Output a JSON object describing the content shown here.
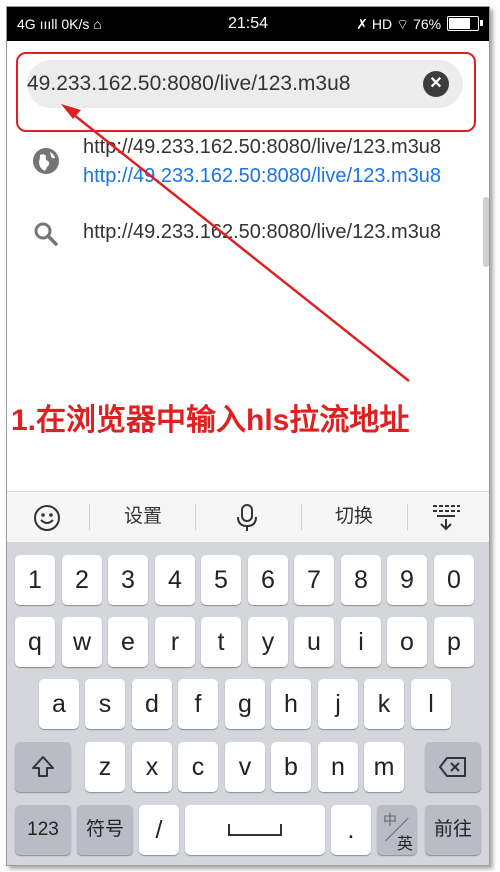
{
  "status_bar": {
    "left": "4G ıııll  0K/s ⌂",
    "time": "21:54",
    "right": "HD ⌔ 76%"
  },
  "url_bar": {
    "value": "49.233.162.50:8080/live/123.m3u8",
    "clear_icon": "close-icon"
  },
  "suggestions": [
    {
      "icon": "globe-icon",
      "title": "http://49.233.162.50:8080/live/123.m3u8",
      "url": "http://49.233.162.50:8080/live/123.m3u8"
    },
    {
      "icon": "search-icon",
      "title": "http://49.233.162.50:8080/live/123.m3u8"
    }
  ],
  "annotation": {
    "text": "1.在浏览器中输入hls拉流地址",
    "color": "#e02020"
  },
  "keyboard_toolbar": {
    "emoji_icon": "smiley-icon",
    "settings": "设置",
    "voice_icon": "microphone-icon",
    "switch": "切换",
    "collapse_icon": "keyboard-collapse-icon"
  },
  "keyboard": {
    "numbers": [
      "1",
      "2",
      "3",
      "4",
      "5",
      "6",
      "7",
      "8",
      "9",
      "0"
    ],
    "row1": [
      "q",
      "w",
      "e",
      "r",
      "t",
      "y",
      "u",
      "i",
      "o",
      "p"
    ],
    "row2": [
      "a",
      "s",
      "d",
      "f",
      "g",
      "h",
      "j",
      "k",
      "l"
    ],
    "row3": [
      "z",
      "x",
      "c",
      "v",
      "b",
      "n",
      "m"
    ],
    "shift_icon": "shift-icon",
    "backspace_icon": "backspace-icon",
    "bottom": {
      "num_mode": "123",
      "symbols": "符号",
      "slash": "/",
      "space": "⎵",
      "period": ".",
      "lang_top": "中",
      "lang_bottom": "英",
      "go": "前往"
    }
  }
}
